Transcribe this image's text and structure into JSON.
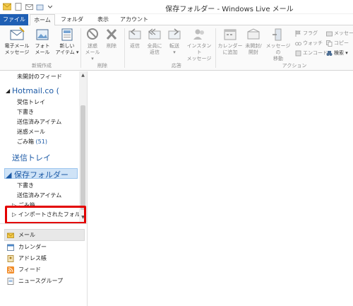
{
  "window": {
    "title": "保存フォルダー - Windows Live メール"
  },
  "tabs": {
    "file": "ファイル",
    "home": "ホーム",
    "folder": "フォルダー",
    "view": "表示",
    "account": "アカウント"
  },
  "ribbon": {
    "new_email": "電子メール\nメッセージ",
    "photo_mail": "フォト\nメール",
    "new_items": "新しい\nアイテム ▾",
    "group_new": "新規作成",
    "junk": "迷惑\nメール ▾",
    "delete": "削除",
    "group_delete": "削除",
    "reply": "返信",
    "reply_all": "全員に\n返信",
    "forward": "転送\n▾",
    "im": "インスタント\nメッセージ",
    "group_respond": "応答",
    "add_calendar": "カレンダー\nに追加",
    "unread": "未開封/\n開封",
    "move_to": "メッセージの\n移動",
    "group_actions": "アクション",
    "flag": "フラグ",
    "watch": "ウォッチ",
    "encode": "エンコード",
    "message_more": "メッセー",
    "copy": "コピー",
    "find": "検索 ▾"
  },
  "nav": {
    "unread_feeds": "未開封のフィード",
    "hotmail_account": "Hotmail.co (",
    "inbox": "受信トレイ",
    "drafts": "下書き",
    "sent": "送信済みアイテム",
    "junk": "迷惑メール",
    "trash": "ごみ箱",
    "trash_count": "(51)",
    "outbox": "送信トレイ",
    "storage_folder": "◢ 保存フォルダー",
    "sf_drafts": "下書き",
    "sf_sent": "送信済みアイテム",
    "sf_trash": "▷ ごみ箱",
    "sf_imported": "▷ インポートされたフォルダ…"
  },
  "bottom_nav": {
    "mail": "メール",
    "calendar": "カレンダー",
    "contacts": "アドレス帳",
    "feeds": "フィード",
    "newsgroups": "ニュースグループ"
  },
  "colors": {
    "file_tab": "#1f5fb4",
    "account_blue": "#1c5aa6",
    "highlight": "#e30000",
    "selection": "#cfe3f7"
  }
}
